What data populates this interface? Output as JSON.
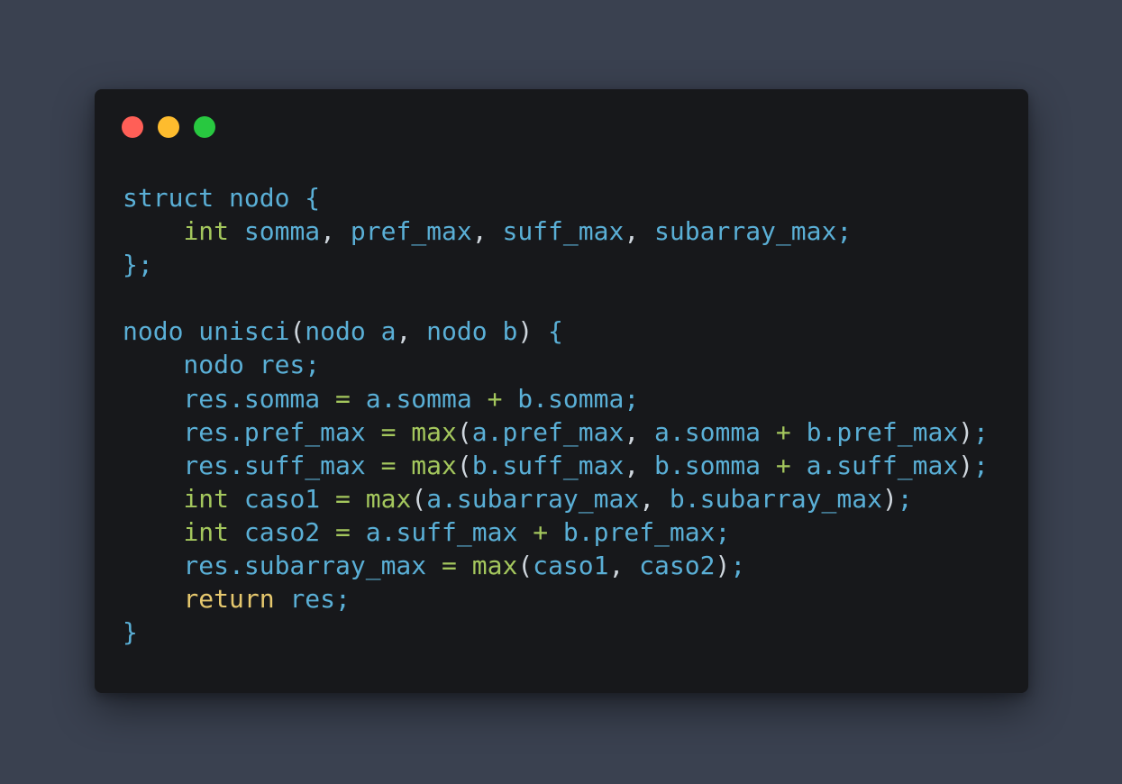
{
  "window": {
    "controls": [
      "close",
      "minimize",
      "maximize"
    ]
  },
  "colors": {
    "background": "#3a4150",
    "editor": "#17181b",
    "identifier": "#5aafd6",
    "type_and_function": "#a4c75d",
    "keyword_return": "#e6c86e",
    "punctuation": "#cfd6dd",
    "close_dot": "#ff5f57",
    "minimize_dot": "#febc2e",
    "maximize_dot": "#28c840"
  },
  "code": {
    "lines": [
      [
        {
          "t": "struct nodo {",
          "c": "id"
        }
      ],
      [
        {
          "t": "    ",
          "c": "id"
        },
        {
          "t": "int",
          "c": "type"
        },
        {
          "t": " somma",
          "c": "id"
        },
        {
          "t": ",",
          "c": "punct"
        },
        {
          "t": " pref_max",
          "c": "id"
        },
        {
          "t": ",",
          "c": "punct"
        },
        {
          "t": " suff_max",
          "c": "id"
        },
        {
          "t": ",",
          "c": "punct"
        },
        {
          "t": " subarray_max;",
          "c": "id"
        }
      ],
      [
        {
          "t": "};",
          "c": "id"
        }
      ],
      [
        {
          "t": "",
          "c": "id"
        }
      ],
      [
        {
          "t": "nodo unisci",
          "c": "id"
        },
        {
          "t": "(",
          "c": "punct"
        },
        {
          "t": "nodo a",
          "c": "id"
        },
        {
          "t": ",",
          "c": "punct"
        },
        {
          "t": " nodo b",
          "c": "id"
        },
        {
          "t": ")",
          "c": "punct"
        },
        {
          "t": " {",
          "c": "id"
        }
      ],
      [
        {
          "t": "    nodo res;",
          "c": "id"
        }
      ],
      [
        {
          "t": "    res.somma ",
          "c": "id"
        },
        {
          "t": "=",
          "c": "op"
        },
        {
          "t": " a.somma ",
          "c": "id"
        },
        {
          "t": "+",
          "c": "op"
        },
        {
          "t": " b.somma;",
          "c": "id"
        }
      ],
      [
        {
          "t": "    res.pref_max ",
          "c": "id"
        },
        {
          "t": "=",
          "c": "op"
        },
        {
          "t": " ",
          "c": "id"
        },
        {
          "t": "max",
          "c": "fn"
        },
        {
          "t": "(",
          "c": "punct"
        },
        {
          "t": "a.pref_max",
          "c": "id"
        },
        {
          "t": ",",
          "c": "punct"
        },
        {
          "t": " a.somma ",
          "c": "id"
        },
        {
          "t": "+",
          "c": "op"
        },
        {
          "t": " b.pref_max",
          "c": "id"
        },
        {
          "t": ")",
          "c": "punct"
        },
        {
          "t": ";",
          "c": "id"
        }
      ],
      [
        {
          "t": "    res.suff_max ",
          "c": "id"
        },
        {
          "t": "=",
          "c": "op"
        },
        {
          "t": " ",
          "c": "id"
        },
        {
          "t": "max",
          "c": "fn"
        },
        {
          "t": "(",
          "c": "punct"
        },
        {
          "t": "b.suff_max",
          "c": "id"
        },
        {
          "t": ",",
          "c": "punct"
        },
        {
          "t": " b.somma ",
          "c": "id"
        },
        {
          "t": "+",
          "c": "op"
        },
        {
          "t": " a.suff_max",
          "c": "id"
        },
        {
          "t": ")",
          "c": "punct"
        },
        {
          "t": ";",
          "c": "id"
        }
      ],
      [
        {
          "t": "    ",
          "c": "id"
        },
        {
          "t": "int",
          "c": "type"
        },
        {
          "t": " caso1 ",
          "c": "id"
        },
        {
          "t": "=",
          "c": "op"
        },
        {
          "t": " ",
          "c": "id"
        },
        {
          "t": "max",
          "c": "fn"
        },
        {
          "t": "(",
          "c": "punct"
        },
        {
          "t": "a.subarray_max",
          "c": "id"
        },
        {
          "t": ",",
          "c": "punct"
        },
        {
          "t": " b.subarray_max",
          "c": "id"
        },
        {
          "t": ")",
          "c": "punct"
        },
        {
          "t": ";",
          "c": "id"
        }
      ],
      [
        {
          "t": "    ",
          "c": "id"
        },
        {
          "t": "int",
          "c": "type"
        },
        {
          "t": " caso2 ",
          "c": "id"
        },
        {
          "t": "=",
          "c": "op"
        },
        {
          "t": " a.suff_max ",
          "c": "id"
        },
        {
          "t": "+",
          "c": "op"
        },
        {
          "t": " b.pref_max;",
          "c": "id"
        }
      ],
      [
        {
          "t": "    res.subarray_max ",
          "c": "id"
        },
        {
          "t": "=",
          "c": "op"
        },
        {
          "t": " ",
          "c": "id"
        },
        {
          "t": "max",
          "c": "fn"
        },
        {
          "t": "(",
          "c": "punct"
        },
        {
          "t": "caso1",
          "c": "id"
        },
        {
          "t": ",",
          "c": "punct"
        },
        {
          "t": " caso2",
          "c": "id"
        },
        {
          "t": ")",
          "c": "punct"
        },
        {
          "t": ";",
          "c": "id"
        }
      ],
      [
        {
          "t": "    ",
          "c": "id"
        },
        {
          "t": "return",
          "c": "kw"
        },
        {
          "t": " res;",
          "c": "id"
        }
      ],
      [
        {
          "t": "}",
          "c": "id"
        }
      ]
    ]
  }
}
